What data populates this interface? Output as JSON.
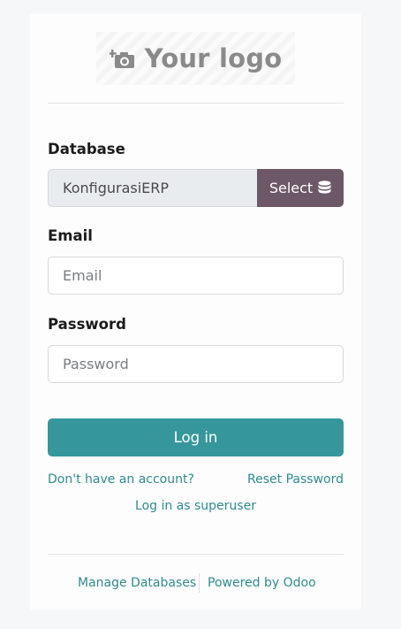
{
  "logo": {
    "text": "Your logo",
    "icon": "camera-plus-icon"
  },
  "database": {
    "label": "Database",
    "value": "KonfigurasiERP",
    "select_label": "Select",
    "select_icon": "database-icon"
  },
  "email": {
    "label": "Email",
    "placeholder": "Email"
  },
  "password": {
    "label": "Password",
    "placeholder": "Password"
  },
  "login_button": "Log in",
  "links": {
    "signup": "Don't have an account?",
    "reset": "Reset Password",
    "superuser": "Log in as superuser"
  },
  "footer": {
    "manage": "Manage Databases",
    "powered": "Powered by Odoo"
  },
  "colors": {
    "accent": "#35979c",
    "select_button": "#6d5867",
    "link": "#2f8a8f"
  }
}
